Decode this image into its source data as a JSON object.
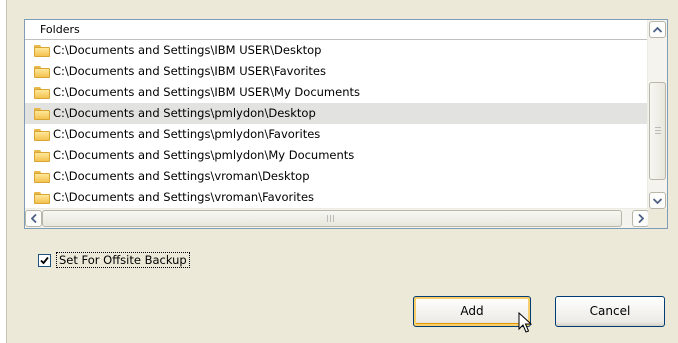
{
  "folder_list": {
    "header": "Folders",
    "rows": [
      {
        "path": "C:\\Documents and Settings\\IBM USER\\Desktop",
        "selected": false
      },
      {
        "path": "C:\\Documents and Settings\\IBM USER\\Favorites",
        "selected": false
      },
      {
        "path": "C:\\Documents and Settings\\IBM USER\\My Documents",
        "selected": false
      },
      {
        "path": "C:\\Documents and Settings\\pmlydon\\Desktop",
        "selected": true
      },
      {
        "path": "C:\\Documents and Settings\\pmlydon\\Favorites",
        "selected": false
      },
      {
        "path": "C:\\Documents and Settings\\pmlydon\\My Documents",
        "selected": false
      },
      {
        "path": "C:\\Documents and Settings\\vroman\\Desktop",
        "selected": false
      },
      {
        "path": "C:\\Documents and Settings\\vroman\\Favorites",
        "selected": false
      }
    ]
  },
  "offsite_backup": {
    "label": "Set For Offsite Backup",
    "checked": true
  },
  "buttons": {
    "add": "Add",
    "cancel": "Cancel"
  },
  "icons": {
    "folder": "folder-icon",
    "scroll_up": "scroll-up-arrow-icon",
    "scroll_down": "scroll-down-arrow-icon",
    "scroll_left": "scroll-left-arrow-icon",
    "scroll_right": "scroll-right-arrow-icon",
    "cursor": "mouse-pointer-icon"
  }
}
